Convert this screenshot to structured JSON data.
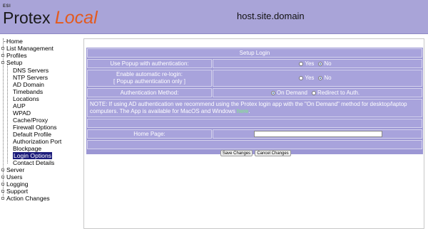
{
  "header": {
    "logo_small": "ESI",
    "logo_main": "Protex",
    "logo_suffix": "Local",
    "host": "host.site.domain"
  },
  "sidebar": {
    "items": [
      {
        "label": "Home"
      },
      {
        "label": "List Management"
      },
      {
        "label": "Profiles"
      },
      {
        "label": "Setup"
      },
      {
        "label": "DNS Servers"
      },
      {
        "label": "NTP Servers"
      },
      {
        "label": "AD Domain"
      },
      {
        "label": "Timebands"
      },
      {
        "label": "Locations"
      },
      {
        "label": "AUP"
      },
      {
        "label": "WPAD"
      },
      {
        "label": "Cache/Proxy"
      },
      {
        "label": "Firewall Options"
      },
      {
        "label": "Default Profile"
      },
      {
        "label": "Authorization Port"
      },
      {
        "label": "Blockpage"
      },
      {
        "label": "Login Options",
        "selected": true
      },
      {
        "label": "Contact Details"
      },
      {
        "label": "Server"
      },
      {
        "label": "Users"
      },
      {
        "label": "Logging"
      },
      {
        "label": "Support"
      },
      {
        "label": "Action Changes"
      }
    ]
  },
  "form": {
    "title": "Setup Login",
    "popup_label": "Use Popup with authentication:",
    "popup_yes": "Yes",
    "popup_no": "No",
    "popup_value": "No",
    "relogin_label_1": "Enable automatic re-login:",
    "relogin_label_2": "[ Popup authentication only ]",
    "relogin_yes": "Yes",
    "relogin_no": "No",
    "relogin_value": "No",
    "auth_label": "Authentication Method:",
    "auth_on_demand": "On Demand",
    "auth_redirect": "Redirect to Auth.",
    "auth_value": "On Demand",
    "note_text": "NOTE: If using AD authentication we recommend using the Protex login app with the \"On Demand\" method for desktop/laptop computers. The App is available for MacOS and Windows ",
    "note_link": "here",
    "note_end": ".",
    "home_page_label": "Home Page:",
    "home_page_value": "",
    "save_button": "Save Changes",
    "cancel_button": "Cancel Changes"
  },
  "colors": {
    "header_bg": "#a9a4d8",
    "panel_bg": "#9c97d4",
    "cell_bg": "#a8a3dc",
    "logo_accent": "#e35a1e",
    "selected_bg": "#1b1b7a",
    "link": "#7cf07c"
  }
}
